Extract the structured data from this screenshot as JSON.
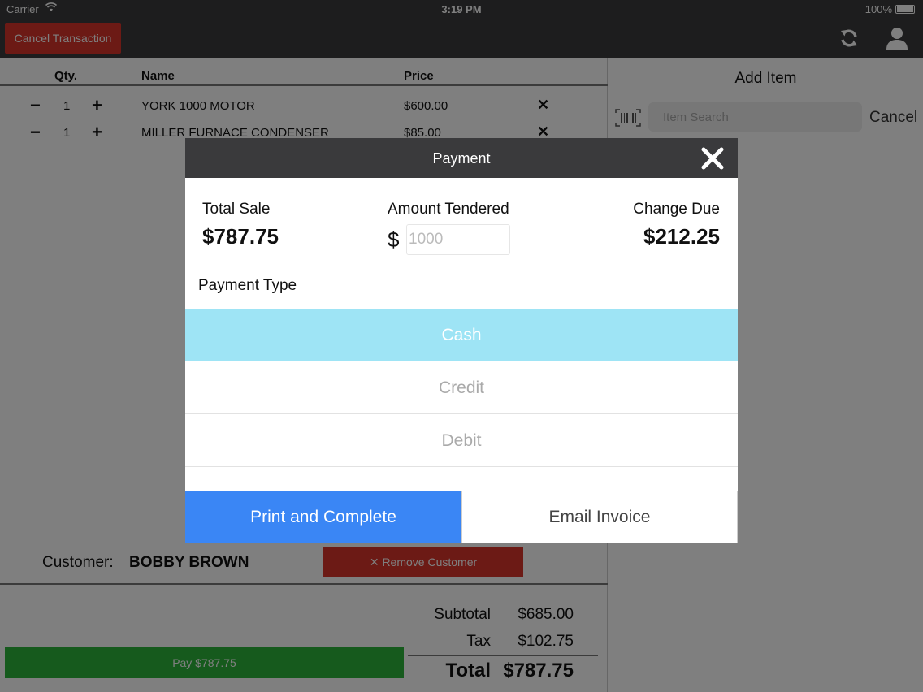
{
  "status_bar": {
    "carrier": "Carrier",
    "time": "3:19 PM",
    "battery": "100%"
  },
  "nav": {
    "cancel_transaction": "Cancel Transaction",
    "icons": {
      "refresh": "refresh-icon",
      "user": "user-icon"
    }
  },
  "cart": {
    "headers": {
      "qty": "Qty.",
      "name": "Name",
      "price": "Price"
    },
    "items": [
      {
        "qty": "1",
        "name": "YORK 1000 MOTOR",
        "price": "$600.00",
        "minus": "−",
        "plus": "+",
        "remove": "✕"
      },
      {
        "qty": "1",
        "name": "MILLER FURNACE CONDENSER",
        "price": "$85.00",
        "minus": "−",
        "plus": "+",
        "remove": "✕"
      }
    ]
  },
  "customer": {
    "label": "Customer:",
    "name": "BOBBY BROWN",
    "remove_button": "✕ Remove Customer"
  },
  "totals": {
    "subtotal_label": "Subtotal",
    "subtotal": "$685.00",
    "tax_label": "Tax",
    "tax": "$102.75",
    "total_label": "Total",
    "total": "$787.75"
  },
  "pay_button": "Pay $787.75",
  "add_item": {
    "title": "Add Item",
    "search_placeholder": "Item Search",
    "cancel": "Cancel"
  },
  "payment_modal": {
    "title": "Payment",
    "total_sale_label": "Total Sale",
    "total_sale": "$787.75",
    "amount_tendered_label": "Amount Tendered",
    "currency": "$",
    "amount_placeholder": "1000",
    "change_due_label": "Change Due",
    "change_due": "$212.25",
    "payment_type_label": "Payment Type",
    "payment_types": [
      "Cash",
      "Credit",
      "Debit"
    ],
    "selected_payment_type": "Cash",
    "print_button": "Print and Complete",
    "email_button": "Email Invoice"
  },
  "colors": {
    "bar": "#3a3a3c",
    "danger": "#d9342b",
    "success": "#2cb43b",
    "primary": "#3a86f5",
    "selected": "#9ee4f5"
  }
}
